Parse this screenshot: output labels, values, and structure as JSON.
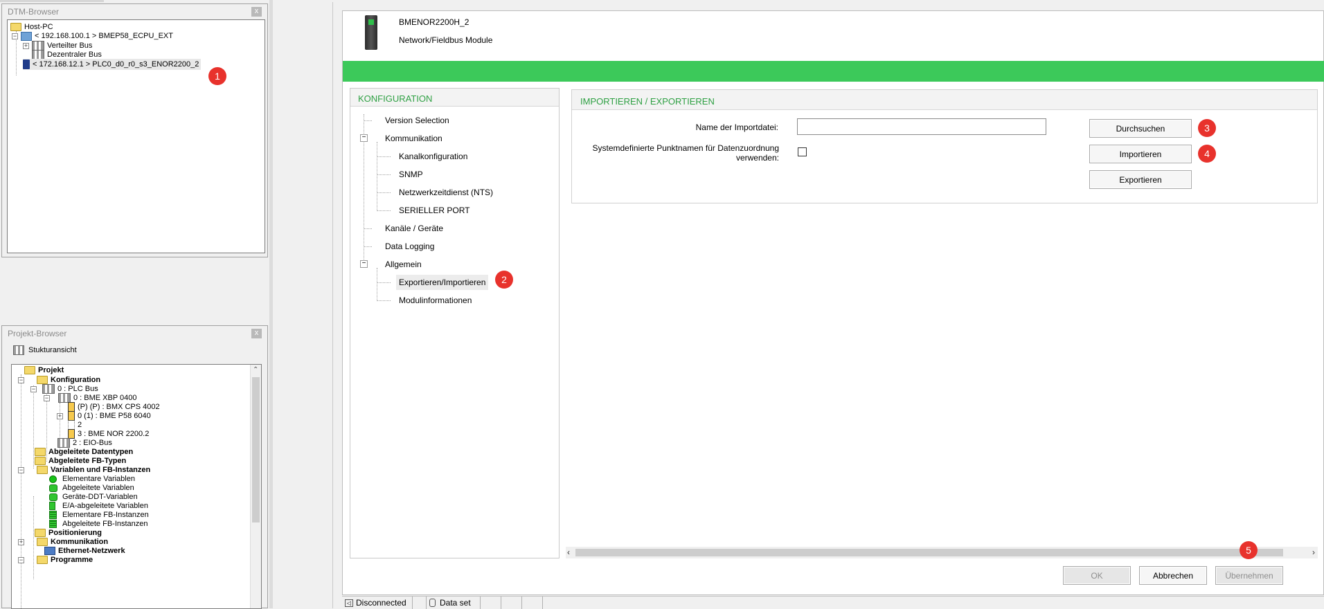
{
  "dtm_browser": {
    "title": "DTM-Browser",
    "close": "x",
    "items": [
      {
        "label": "Host-PC"
      },
      {
        "label": "< 192.168.100.1 > BMEP58_ECPU_EXT"
      },
      {
        "label": "Verteilter Bus"
      },
      {
        "label": "Dezentraler Bus"
      },
      {
        "label": "< 172.168.12.1 > PLC0_d0_r0_s3_ENOR2200_2"
      }
    ]
  },
  "projekt_browser": {
    "title": "Projekt-Browser",
    "close": "x",
    "view_label": "Stukturansicht",
    "items": [
      {
        "label": "Projekt"
      },
      {
        "label": "Konfiguration"
      },
      {
        "label": "0 : PLC Bus"
      },
      {
        "label": "0 : BME XBP 0400"
      },
      {
        "label": "(P) (P) : BMX CPS 4002"
      },
      {
        "label": "0 (1) : BME P58 6040"
      },
      {
        "label": "2"
      },
      {
        "label": "3 : BME NOR 2200.2"
      },
      {
        "label": "2 : EIO-Bus"
      },
      {
        "label": "Abgeleitete Datentypen"
      },
      {
        "label": "Abgeleitete FB-Typen"
      },
      {
        "label": "Variablen und FB-Instanzen"
      },
      {
        "label": "Elementare Variablen"
      },
      {
        "label": "Abgeleitete Variablen"
      },
      {
        "label": "Geräte-DDT-Variablen"
      },
      {
        "label": "E/A-abgeleitete Variablen"
      },
      {
        "label": "Elementare FB-Instanzen"
      },
      {
        "label": "Abgeleitete FB-Instanzen"
      },
      {
        "label": "Positionierung"
      },
      {
        "label": "Kommunikation"
      },
      {
        "label": "Ethernet-Netzwerk"
      },
      {
        "label": "Programme"
      }
    ]
  },
  "device": {
    "name": "BMENOR2200H_2",
    "type": "Network/Fieldbus Module",
    "banner_color": "#3cc95a"
  },
  "nav": {
    "header": "KONFIGURATION",
    "items": [
      {
        "label": "Version Selection"
      },
      {
        "label": "Kommunikation"
      },
      {
        "label": "Kanalkonfiguration"
      },
      {
        "label": "SNMP"
      },
      {
        "label": "Netzwerkzeitdienst (NTS)"
      },
      {
        "label": "SERIELLER PORT"
      },
      {
        "label": "Kanäle / Geräte"
      },
      {
        "label": "Data Logging"
      },
      {
        "label": "Allgemein"
      },
      {
        "label": "Exportieren/Importieren"
      },
      {
        "label": "Modulinformationen"
      }
    ]
  },
  "content": {
    "header": "IMPORTIEREN / EXPORTIEREN",
    "file_label": "Name der Importdatei:",
    "file_value": "",
    "checkbox_label_1": "Systemdefinierte Punktnamen für Datenzuordnung",
    "checkbox_label_2": "verwenden:",
    "checkbox_checked": false,
    "browse_button": "Durchsuchen",
    "import_button": "Importieren",
    "export_button": "Exportieren"
  },
  "footer": {
    "ok": "OK",
    "cancel": "Abbrechen",
    "apply": "Übernehmen"
  },
  "status_bar": {
    "connection": "Disconnected",
    "data_set": "Data set"
  },
  "badges": [
    "1",
    "2",
    "3",
    "4",
    "5"
  ],
  "colors": {
    "accent_green": "#2ea043",
    "badge_red": "#e8322c"
  }
}
